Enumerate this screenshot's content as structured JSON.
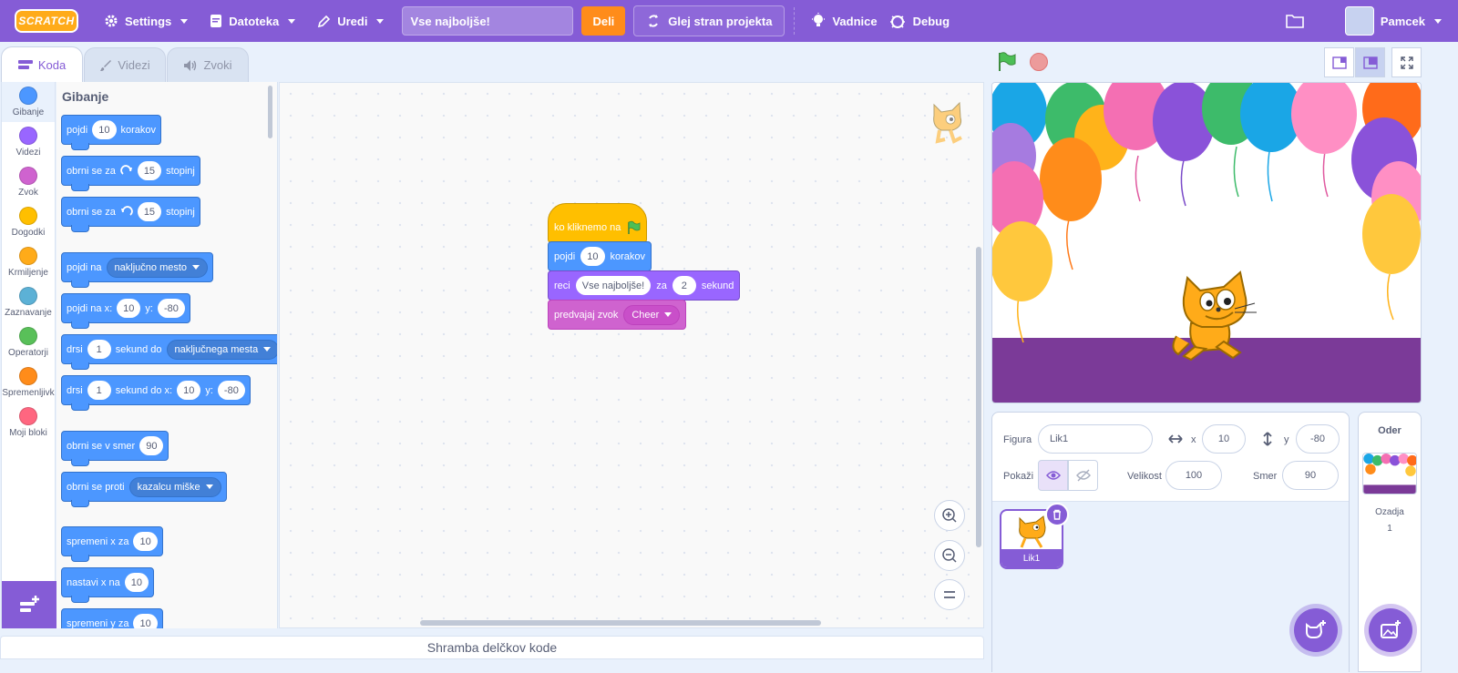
{
  "menu": {
    "logo": "SCRATCH",
    "settings": "Settings",
    "file": "Datoteka",
    "edit": "Uredi",
    "project_title": "Vse najboljše!",
    "share": "Deli",
    "see_project": "Glej stran projekta",
    "tutorials": "Vadnice",
    "debug": "Debug",
    "username": "Pamcek"
  },
  "tabs": [
    "Koda",
    "Videzi",
    "Zvoki"
  ],
  "categories": [
    {
      "label": "Gibanje",
      "color": "#4c97ff"
    },
    {
      "label": "Videzi",
      "color": "#9966ff"
    },
    {
      "label": "Zvok",
      "color": "#cf63cf"
    },
    {
      "label": "Dogodki",
      "color": "#ffbf00"
    },
    {
      "label": "Krmiljenje",
      "color": "#ffab19"
    },
    {
      "label": "Zaznavanje",
      "color": "#5cb1d6"
    },
    {
      "label": "Operatorji",
      "color": "#59c059"
    },
    {
      "label": "Spremenljivk",
      "color": "#ff8c1a"
    },
    {
      "label": "Moji bloki",
      "color": "#ff6680"
    }
  ],
  "palette": {
    "title": "Gibanje",
    "b1": {
      "a": "pojdi",
      "v": "10",
      "b": "korakov"
    },
    "b2": {
      "a": "obrni se za",
      "v": "15",
      "b": "stopinj"
    },
    "b3": {
      "a": "obrni se za",
      "v": "15",
      "b": "stopinj"
    },
    "b4": {
      "a": "pojdi na",
      "d": "naključno mesto"
    },
    "b5": {
      "a": "pojdi na x:",
      "v": "10",
      "b": "y:",
      "w": "-80"
    },
    "b6": {
      "a": "drsi",
      "v": "1",
      "b": "sekund do",
      "d": "naključnega mesta"
    },
    "b7": {
      "a": "drsi",
      "v": "1",
      "b": "sekund do x:",
      "w": "10",
      "c": "y:",
      "z": "-80"
    },
    "b8": {
      "a": "obrni se v smer",
      "v": "90"
    },
    "b9": {
      "a": "obrni se proti",
      "d": "kazalcu miške"
    },
    "b10": {
      "a": "spremeni x za",
      "v": "10"
    },
    "b11": {
      "a": "nastavi x na",
      "v": "10"
    },
    "b12": {
      "a": "spremeni y za",
      "v": "10"
    }
  },
  "script": {
    "hat": "ko kliknemo na",
    "move": {
      "a": "pojdi",
      "v": "10",
      "b": "korakov"
    },
    "say": {
      "a": "reci",
      "v": "Vse najboljše!",
      "b": "za",
      "w": "2",
      "c": "sekund"
    },
    "sound": {
      "a": "predvajaj zvok",
      "d": "Cheer"
    }
  },
  "backpack": "Shramba delčkov kode",
  "sprite_info": {
    "sprite_label": "Figura",
    "sprite_name": "Lik1",
    "x_label": "x",
    "x": "10",
    "y_label": "y",
    "y": "-80",
    "show_label": "Pokaži",
    "size_label": "Velikost",
    "size": "100",
    "direction_label": "Smer",
    "direction": "90"
  },
  "sprites": [
    {
      "name": "Lik1"
    }
  ],
  "stage_panel": {
    "title": "Oder",
    "backdrops_label": "Ozadja",
    "backdrops_count": "1"
  },
  "colors": {
    "accent": "#855cd6",
    "motion": "#4c97ff",
    "share": "#ff8c1a"
  }
}
